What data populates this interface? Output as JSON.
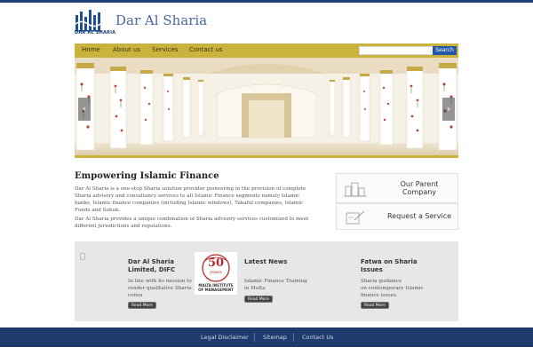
{
  "header": {
    "logo_text": "DAR AL SHARIA",
    "site_title": "Dar Al Sharia"
  },
  "nav": {
    "items": [
      "Home",
      "About us",
      "Services",
      "Contact us"
    ]
  },
  "search": {
    "value": "",
    "button_label": "Search"
  },
  "slider": {
    "prev_label": "‹",
    "next_label": "›"
  },
  "intro": {
    "title": "Empowering Islamic Finance",
    "paragraph1": "Dar Al Sharia is a one-stop Sharia solution provider pioneering in the provision of complete Sharia advisory and consultancy services to all Islamic Finance segments namely Islamic banks, Islamic finance companies (including Islamic windows), Takaful companies, Islamic Funds and Sukuk.",
    "paragraph2": "Dar Al Sharia provides a unique combination of Sharia  advisory services customized to meet different jurisdictions and regulations."
  },
  "side_boxes": {
    "parent_line1": "Our Parent",
    "parent_line2": "Company",
    "service_label": "Request a Service"
  },
  "features": {
    "col1_title_line1": "Dar Al Sharia",
    "col1_title_line2": "Limited, DIFC",
    "col1_text_line1": "In line with its mission to",
    "col1_text_line2": "render qualitative Sharia",
    "col1_text_line3": "consu",
    "badge_number": "50",
    "badge_years": "years",
    "badge_line1": "MALTA INSTITUTE",
    "badge_line2": "OF MANAGEMENT",
    "col2_title": "Latest News",
    "col2_text_line1": "Islamic Finance Training",
    "col2_text_line2": "in Malta",
    "col3_title_line1": "Fatwa on Sharia",
    "col3_title_line2": "Issues",
    "col3_text_line1": "Sharia guidance",
    "col3_text_line2": "on contemporary Islamic",
    "col3_text_line3": "finance issues.",
    "read_more": "Read More"
  },
  "footer": {
    "links": [
      "Legal Disclaimer",
      "Sitemap",
      "Contact Us"
    ]
  },
  "colors": {
    "accent_gold": "#c9b33c",
    "brand_blue": "#1e3b6e",
    "search_button": "#2457a5"
  }
}
